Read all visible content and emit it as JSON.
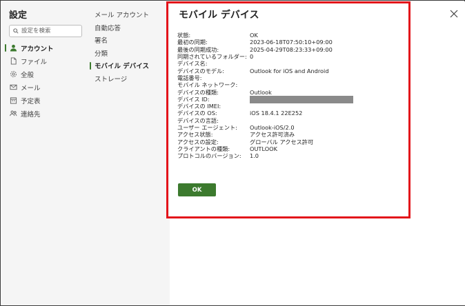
{
  "nav": {
    "title": "設定",
    "search_placeholder": "設定を検索",
    "items": [
      {
        "label": "アカウント",
        "icon": "person-icon",
        "active": true
      },
      {
        "label": "ファイル",
        "icon": "file-icon",
        "active": false
      },
      {
        "label": "全般",
        "icon": "gear-icon",
        "active": false
      },
      {
        "label": "メール",
        "icon": "mail-icon",
        "active": false
      },
      {
        "label": "予定表",
        "icon": "calendar-icon",
        "active": false
      },
      {
        "label": "連絡先",
        "icon": "people-icon",
        "active": false
      }
    ]
  },
  "sub": {
    "items": [
      {
        "label": "メール アカウント",
        "active": false
      },
      {
        "label": "自動応答",
        "active": false
      },
      {
        "label": "署名",
        "active": false
      },
      {
        "label": "分類",
        "active": false
      },
      {
        "label": "モバイル デバイス",
        "active": true
      },
      {
        "label": "ストレージ",
        "active": false
      }
    ]
  },
  "main": {
    "title": "モバイル デバイス",
    "ok_label": "OK",
    "properties": [
      {
        "label": "状態:",
        "value": "OK"
      },
      {
        "label": "最初の同期:",
        "value": "2023-06-18T07:50:10+09:00"
      },
      {
        "label": "最後の同期成功:",
        "value": "2025-04-29T08:23:33+09:00"
      },
      {
        "label": "同期されているフォルダー:",
        "value": "0"
      },
      {
        "label": "デバイス名:",
        "value": ""
      },
      {
        "label": "デバイスのモデル:",
        "value": "Outlook for iOS and Android"
      },
      {
        "label": "電話番号:",
        "value": ""
      },
      {
        "label": "モバイル ネットワーク:",
        "value": ""
      },
      {
        "label": "デバイスの種類:",
        "value": "Outlook"
      },
      {
        "label": "デバイス ID:",
        "value": "",
        "redacted": true
      },
      {
        "label": "デバイスの IMEI:",
        "value": ""
      },
      {
        "label": "デバイスの OS:",
        "value": "iOS 18.4.1 22E252"
      },
      {
        "label": "デバイスの言語:",
        "value": ""
      },
      {
        "label": "ユーザー エージェント:",
        "value": "Outlook-iOS/2.0"
      },
      {
        "label": "アクセス状態:",
        "value": "アクセス許可済み"
      },
      {
        "label": "アクセスの設定:",
        "value": "グローバル アクセス許可"
      },
      {
        "label": "クライアントの種類:",
        "value": "OUTLOOK"
      },
      {
        "label": "プロトコルのバージョン:",
        "value": "1.0"
      }
    ]
  },
  "colors": {
    "accent": "#3c7a2e",
    "highlight": "#e3131a",
    "redacted": "#8a8a8a"
  }
}
